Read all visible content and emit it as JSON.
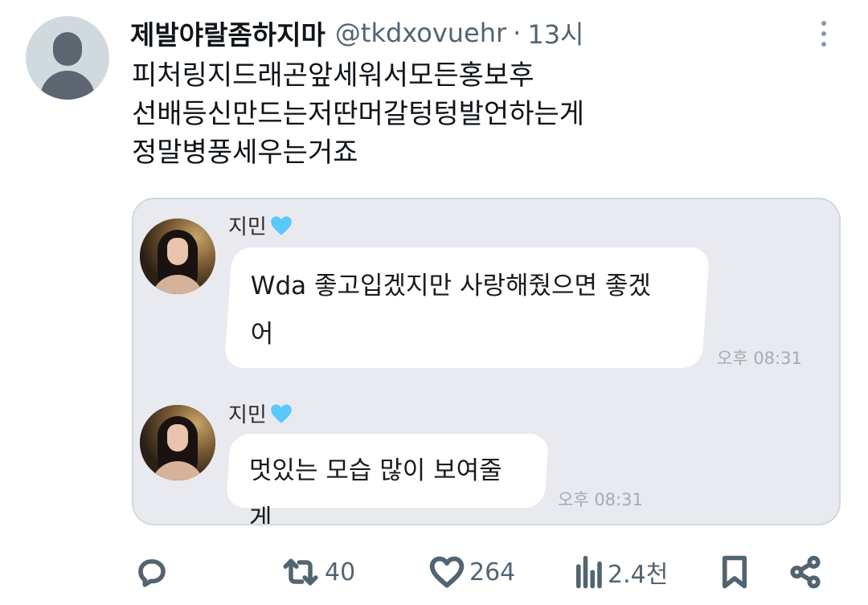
{
  "tweet": {
    "display_name": "제발야랄좀하지마",
    "handle": "@tkdxovuehr",
    "separator": "·",
    "time": "13시",
    "lines": [
      "피처링지드래곤앞세워서모든홍보후",
      "선배등신만드는저딴머갈텅텅발언하는게",
      "정말병풍세우는거죠"
    ]
  },
  "chat": {
    "messages": [
      {
        "sender": "지민",
        "lines": [
          "Wda 좋고입겠지만 사랑해줬으면 좋겠",
          "어"
        ],
        "time": "오후 08:31"
      },
      {
        "sender": "지민",
        "lines": [
          "멋있는 모습 많이 보여줄게"
        ],
        "time": "오후 08:31"
      }
    ]
  },
  "actions": {
    "reply_count": "",
    "retweet_count": "40",
    "like_count": "264",
    "view_count": "2.4천"
  },
  "colors": {
    "text_primary": "#0f1419",
    "text_secondary": "#536471",
    "heart_emoji": "#5ac8fa",
    "media_bg": "#e9eaef"
  },
  "icons": [
    "reply-icon",
    "retweet-icon",
    "like-icon",
    "views-icon",
    "bookmark-icon",
    "share-icon",
    "more-icon",
    "blue-heart-icon"
  ]
}
